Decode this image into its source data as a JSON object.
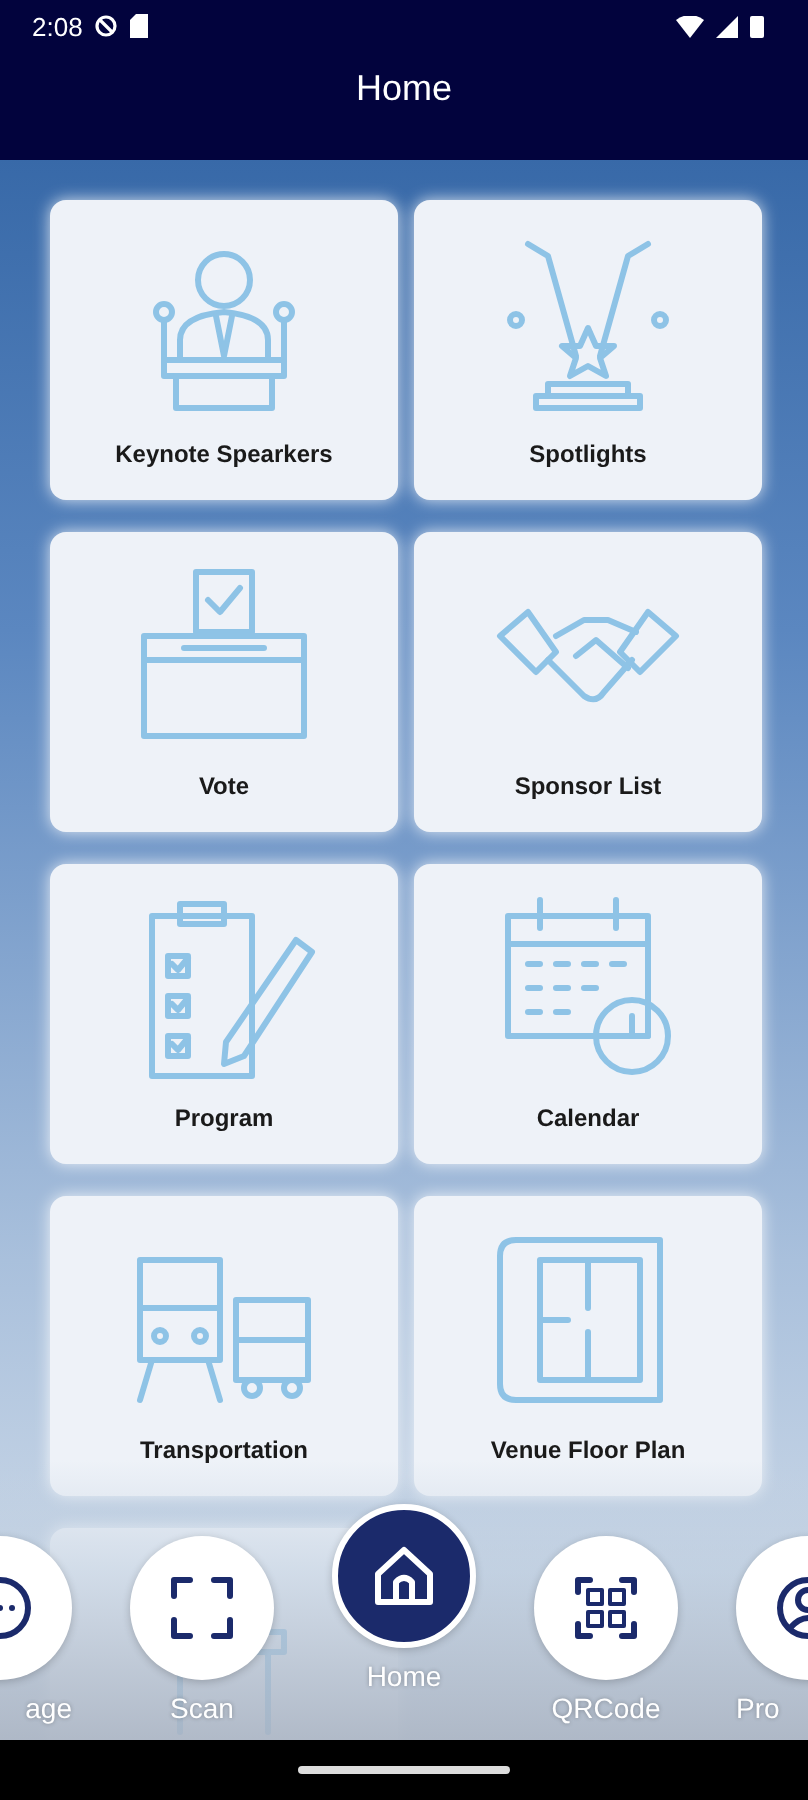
{
  "status_bar": {
    "time": "2:08"
  },
  "header": {
    "title": "Home"
  },
  "tiles": [
    {
      "label": "Keynote Spearkers",
      "kind": "speaker"
    },
    {
      "label": "Spotlights",
      "kind": "spotlight"
    },
    {
      "label": "Vote",
      "kind": "vote"
    },
    {
      "label": "Sponsor List",
      "kind": "handshake"
    },
    {
      "label": "Program",
      "kind": "checklist"
    },
    {
      "label": "Calendar",
      "kind": "calendar"
    },
    {
      "label": "Transportation",
      "kind": "transport"
    },
    {
      "label": "Venue Floor Plan",
      "kind": "floorplan"
    },
    {
      "kind": "desk"
    }
  ],
  "bottom_nav": [
    {
      "label": "age",
      "kind": "chat",
      "selected": false
    },
    {
      "label": "Scan",
      "kind": "scan",
      "selected": false
    },
    {
      "label": "Home",
      "kind": "home",
      "selected": true
    },
    {
      "label": "QRCode",
      "kind": "qr",
      "selected": false
    },
    {
      "label": "Pro",
      "kind": "profile",
      "selected": false
    }
  ]
}
